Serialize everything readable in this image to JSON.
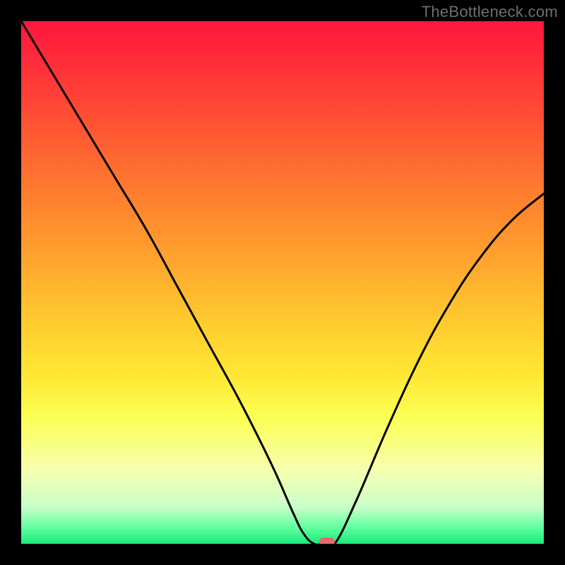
{
  "watermark": "TheBottleneck.com",
  "chart_data": {
    "type": "line",
    "title": "",
    "xlabel": "",
    "ylabel": "",
    "xlim": [
      0,
      100
    ],
    "ylim": [
      0,
      100
    ],
    "x": [
      0,
      6,
      12,
      18,
      24,
      30,
      36,
      42,
      48,
      52,
      54,
      56,
      58,
      60,
      64,
      70,
      76,
      82,
      88,
      94,
      100
    ],
    "values": [
      100,
      90,
      80,
      70,
      60,
      49,
      38,
      27,
      15,
      6,
      2,
      0,
      0,
      0,
      8,
      22,
      35,
      46,
      55,
      62,
      67
    ],
    "marker": {
      "x": 58.5,
      "y": 0
    },
    "gradient_stops": [
      {
        "pos": 0.0,
        "color": "#ff173e"
      },
      {
        "pos": 0.08,
        "color": "#ff2d3a"
      },
      {
        "pos": 0.2,
        "color": "#ff5433"
      },
      {
        "pos": 0.32,
        "color": "#ff7a2f"
      },
      {
        "pos": 0.45,
        "color": "#ffa22e"
      },
      {
        "pos": 0.57,
        "color": "#ffc92f"
      },
      {
        "pos": 0.68,
        "color": "#ffe834"
      },
      {
        "pos": 0.76,
        "color": "#fcff55"
      },
      {
        "pos": 0.86,
        "color": "#f6ffb0"
      },
      {
        "pos": 0.93,
        "color": "#c8ffc9"
      },
      {
        "pos": 0.97,
        "color": "#5eff9e"
      },
      {
        "pos": 1.0,
        "color": "#18e87a"
      }
    ]
  }
}
